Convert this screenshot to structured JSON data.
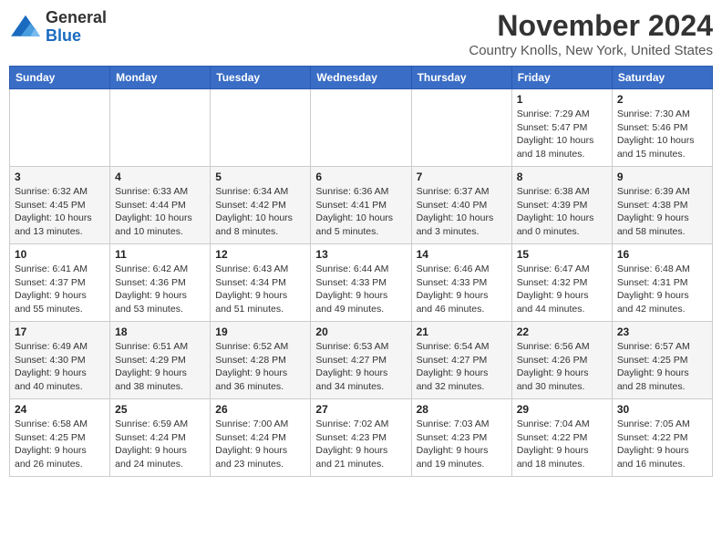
{
  "header": {
    "logo_general": "General",
    "logo_blue": "Blue",
    "month_year": "November 2024",
    "location": "Country Knolls, New York, United States"
  },
  "weekdays": [
    "Sunday",
    "Monday",
    "Tuesday",
    "Wednesday",
    "Thursday",
    "Friday",
    "Saturday"
  ],
  "weeks": [
    [
      {
        "day": "",
        "info": ""
      },
      {
        "day": "",
        "info": ""
      },
      {
        "day": "",
        "info": ""
      },
      {
        "day": "",
        "info": ""
      },
      {
        "day": "",
        "info": ""
      },
      {
        "day": "1",
        "info": "Sunrise: 7:29 AM\nSunset: 5:47 PM\nDaylight: 10 hours and 18 minutes."
      },
      {
        "day": "2",
        "info": "Sunrise: 7:30 AM\nSunset: 5:46 PM\nDaylight: 10 hours and 15 minutes."
      }
    ],
    [
      {
        "day": "3",
        "info": "Sunrise: 6:32 AM\nSunset: 4:45 PM\nDaylight: 10 hours and 13 minutes."
      },
      {
        "day": "4",
        "info": "Sunrise: 6:33 AM\nSunset: 4:44 PM\nDaylight: 10 hours and 10 minutes."
      },
      {
        "day": "5",
        "info": "Sunrise: 6:34 AM\nSunset: 4:42 PM\nDaylight: 10 hours and 8 minutes."
      },
      {
        "day": "6",
        "info": "Sunrise: 6:36 AM\nSunset: 4:41 PM\nDaylight: 10 hours and 5 minutes."
      },
      {
        "day": "7",
        "info": "Sunrise: 6:37 AM\nSunset: 4:40 PM\nDaylight: 10 hours and 3 minutes."
      },
      {
        "day": "8",
        "info": "Sunrise: 6:38 AM\nSunset: 4:39 PM\nDaylight: 10 hours and 0 minutes."
      },
      {
        "day": "9",
        "info": "Sunrise: 6:39 AM\nSunset: 4:38 PM\nDaylight: 9 hours and 58 minutes."
      }
    ],
    [
      {
        "day": "10",
        "info": "Sunrise: 6:41 AM\nSunset: 4:37 PM\nDaylight: 9 hours and 55 minutes."
      },
      {
        "day": "11",
        "info": "Sunrise: 6:42 AM\nSunset: 4:36 PM\nDaylight: 9 hours and 53 minutes."
      },
      {
        "day": "12",
        "info": "Sunrise: 6:43 AM\nSunset: 4:34 PM\nDaylight: 9 hours and 51 minutes."
      },
      {
        "day": "13",
        "info": "Sunrise: 6:44 AM\nSunset: 4:33 PM\nDaylight: 9 hours and 49 minutes."
      },
      {
        "day": "14",
        "info": "Sunrise: 6:46 AM\nSunset: 4:33 PM\nDaylight: 9 hours and 46 minutes."
      },
      {
        "day": "15",
        "info": "Sunrise: 6:47 AM\nSunset: 4:32 PM\nDaylight: 9 hours and 44 minutes."
      },
      {
        "day": "16",
        "info": "Sunrise: 6:48 AM\nSunset: 4:31 PM\nDaylight: 9 hours and 42 minutes."
      }
    ],
    [
      {
        "day": "17",
        "info": "Sunrise: 6:49 AM\nSunset: 4:30 PM\nDaylight: 9 hours and 40 minutes."
      },
      {
        "day": "18",
        "info": "Sunrise: 6:51 AM\nSunset: 4:29 PM\nDaylight: 9 hours and 38 minutes."
      },
      {
        "day": "19",
        "info": "Sunrise: 6:52 AM\nSunset: 4:28 PM\nDaylight: 9 hours and 36 minutes."
      },
      {
        "day": "20",
        "info": "Sunrise: 6:53 AM\nSunset: 4:27 PM\nDaylight: 9 hours and 34 minutes."
      },
      {
        "day": "21",
        "info": "Sunrise: 6:54 AM\nSunset: 4:27 PM\nDaylight: 9 hours and 32 minutes."
      },
      {
        "day": "22",
        "info": "Sunrise: 6:56 AM\nSunset: 4:26 PM\nDaylight: 9 hours and 30 minutes."
      },
      {
        "day": "23",
        "info": "Sunrise: 6:57 AM\nSunset: 4:25 PM\nDaylight: 9 hours and 28 minutes."
      }
    ],
    [
      {
        "day": "24",
        "info": "Sunrise: 6:58 AM\nSunset: 4:25 PM\nDaylight: 9 hours and 26 minutes."
      },
      {
        "day": "25",
        "info": "Sunrise: 6:59 AM\nSunset: 4:24 PM\nDaylight: 9 hours and 24 minutes."
      },
      {
        "day": "26",
        "info": "Sunrise: 7:00 AM\nSunset: 4:24 PM\nDaylight: 9 hours and 23 minutes."
      },
      {
        "day": "27",
        "info": "Sunrise: 7:02 AM\nSunset: 4:23 PM\nDaylight: 9 hours and 21 minutes."
      },
      {
        "day": "28",
        "info": "Sunrise: 7:03 AM\nSunset: 4:23 PM\nDaylight: 9 hours and 19 minutes."
      },
      {
        "day": "29",
        "info": "Sunrise: 7:04 AM\nSunset: 4:22 PM\nDaylight: 9 hours and 18 minutes."
      },
      {
        "day": "30",
        "info": "Sunrise: 7:05 AM\nSunset: 4:22 PM\nDaylight: 9 hours and 16 minutes."
      }
    ]
  ]
}
